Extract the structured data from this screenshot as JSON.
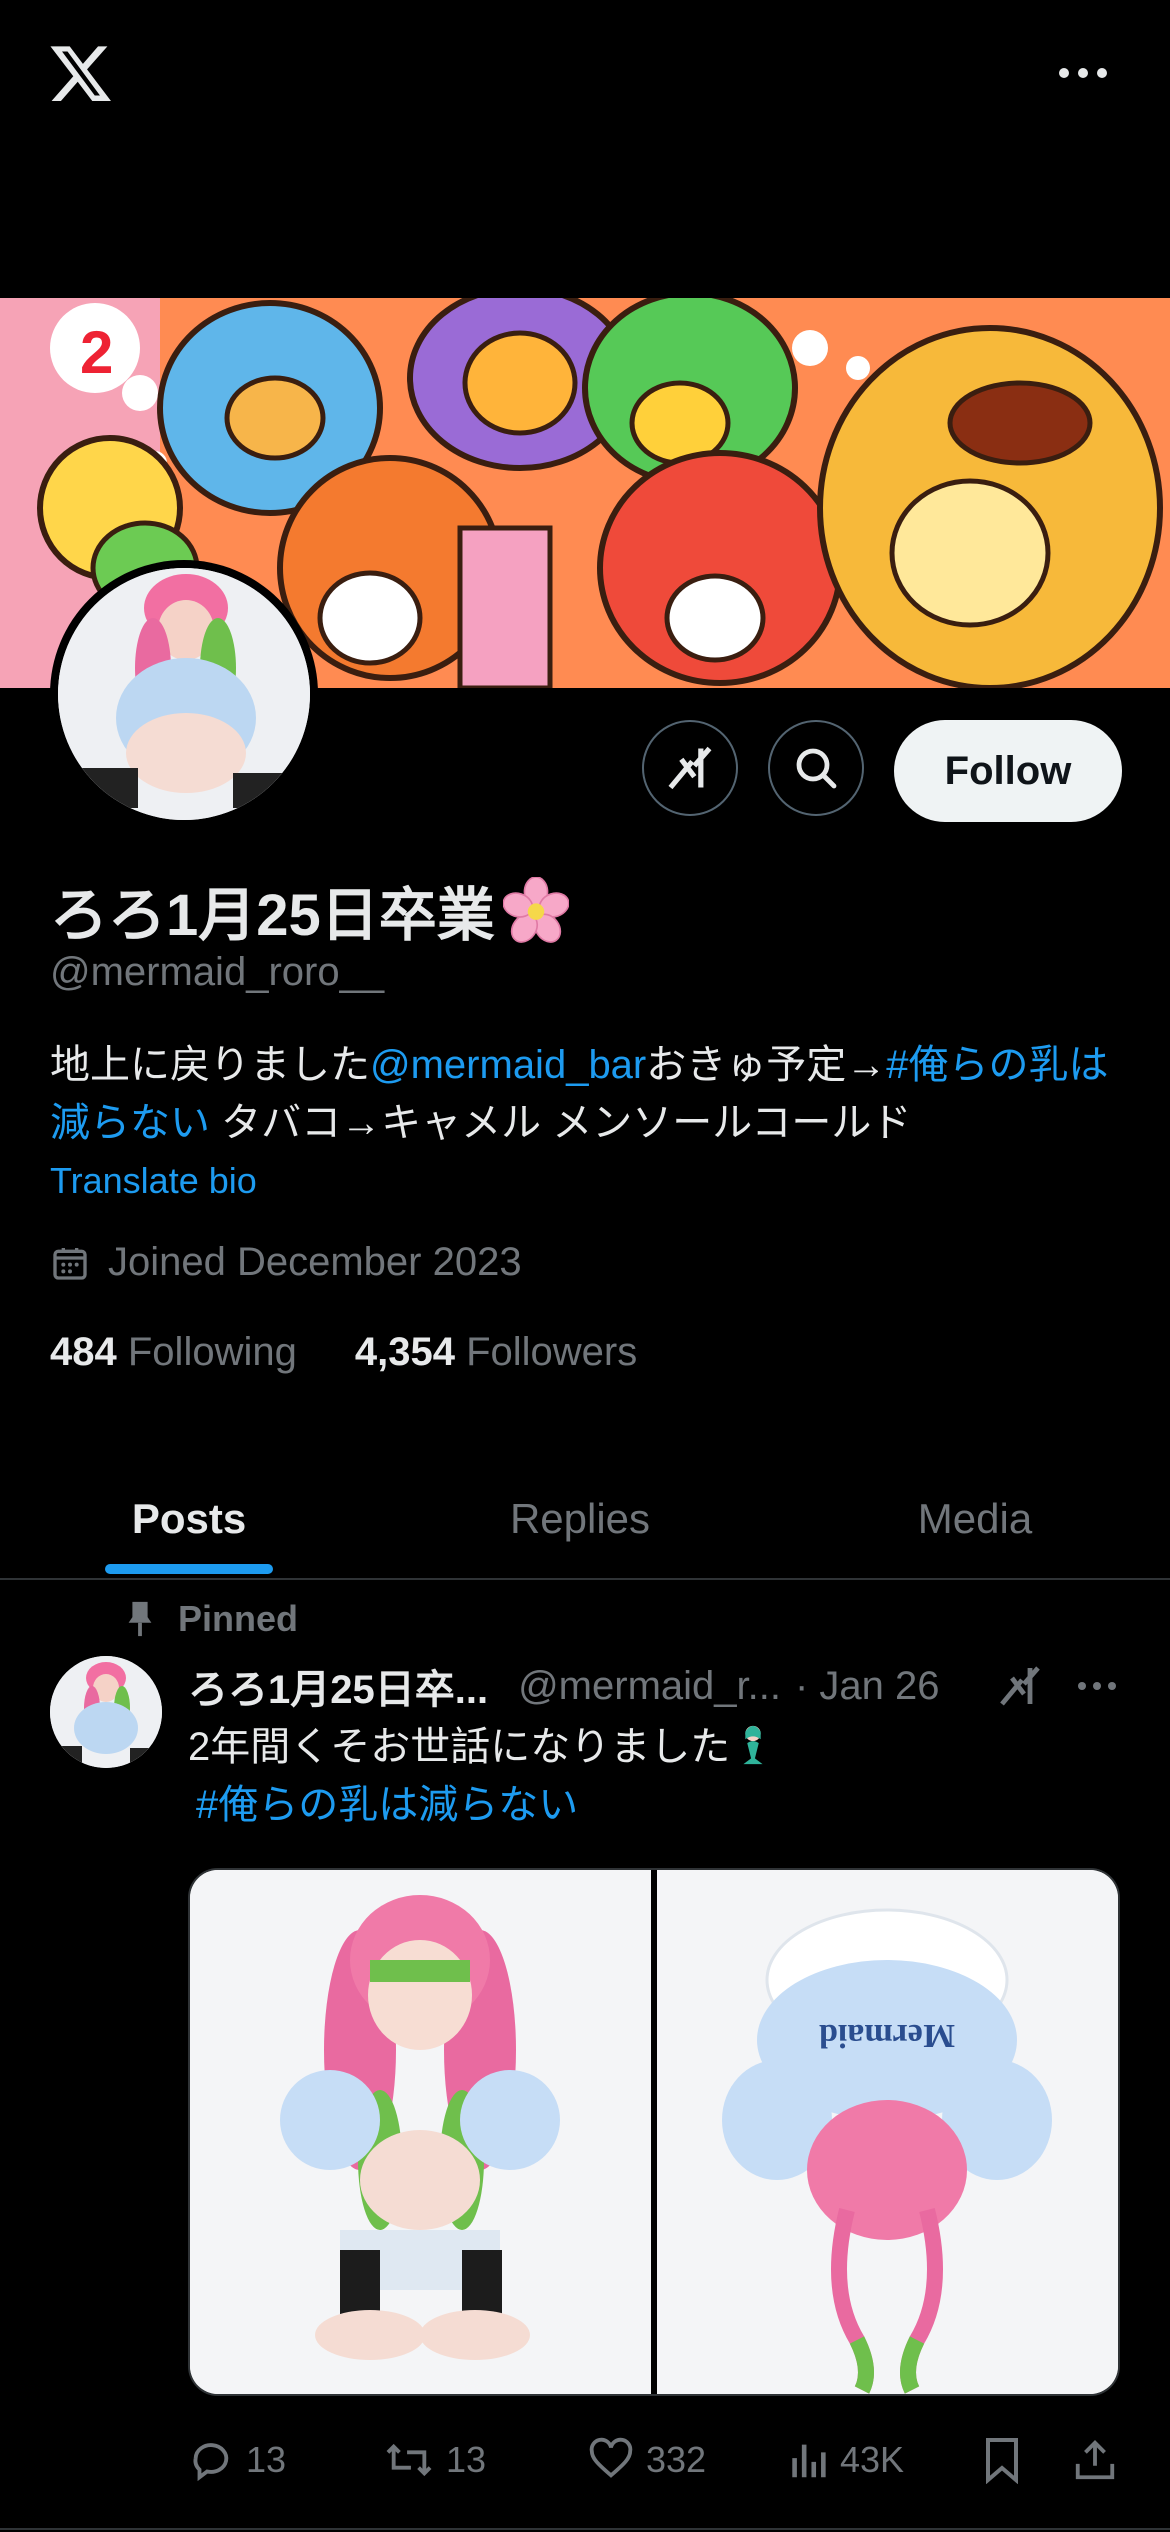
{
  "profile": {
    "display_name": "ろろ1月25日卒業",
    "handle": "@mermaid_roro__",
    "bio": {
      "part1": "地上に戻りました",
      "mention": "@mermaid_bar",
      "part2": "おきゅ予定→",
      "hashtag": "#俺らの乳は減らない",
      "part3": " タバコ→キャメル メンソールコールド"
    },
    "translate_label": "Translate bio",
    "joined": "Joined December 2023",
    "following_count": "484",
    "following_label": "Following",
    "followers_count": "4,354",
    "followers_label": "Followers",
    "follow_label": "Follow"
  },
  "tabs": [
    {
      "label": "Posts",
      "active": true
    },
    {
      "label": "Replies",
      "active": false
    },
    {
      "label": "Media",
      "active": false
    }
  ],
  "post": {
    "pinned_label": "Pinned",
    "name": "ろろ1月25日卒...",
    "handle": "@mermaid_r...",
    "date": "· Jan 26",
    "text": "2年間くそお世話になりました",
    "hashtag": "#俺らの乳は減らない",
    "image_text": "Mermaid",
    "replies": "13",
    "reposts": "13",
    "likes": "332",
    "views": "43K"
  },
  "colors": {
    "accent": "#1d9bf0",
    "background": "#000000",
    "muted": "#71767b"
  }
}
